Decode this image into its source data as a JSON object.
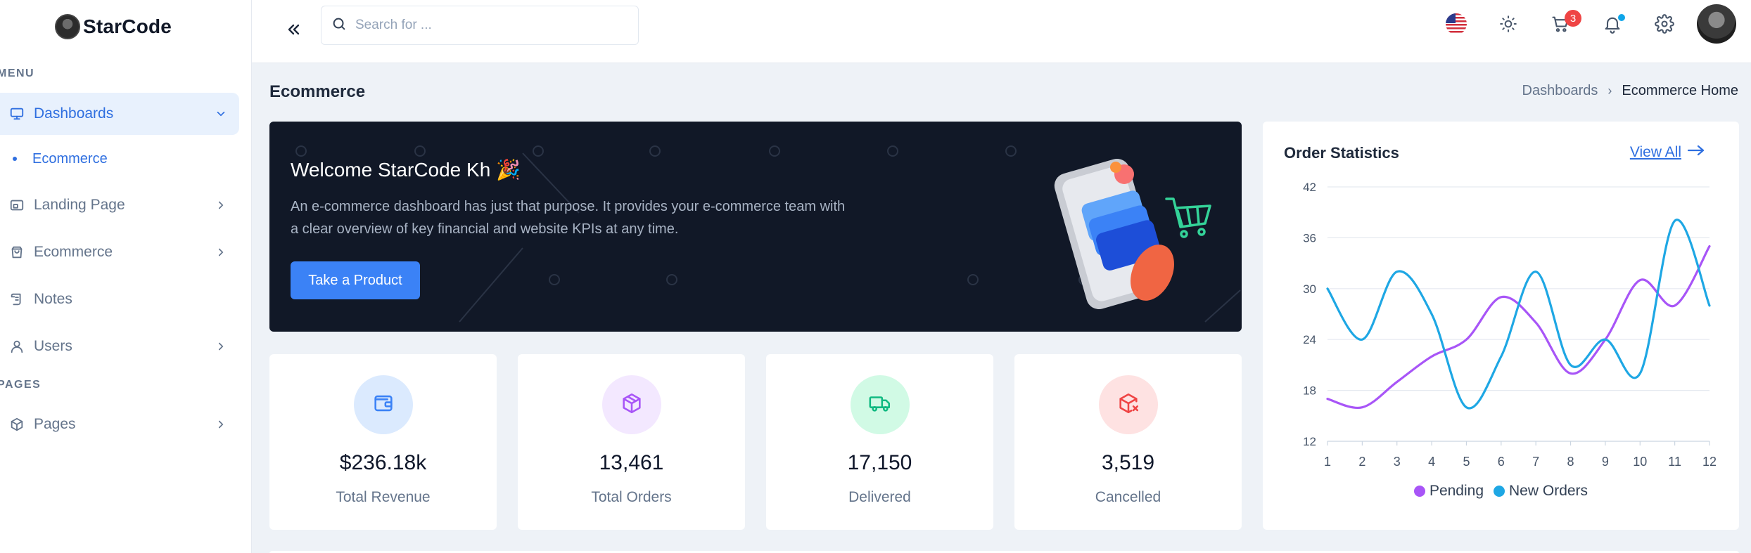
{
  "sidebar": {
    "logo_text": "StarCode",
    "menu_heading": "Menu",
    "pages_heading": "Pages",
    "items": [
      {
        "label": "Dashboards",
        "icon": "monitor-icon",
        "active": true,
        "has_children": true
      },
      {
        "label": "Ecommerce",
        "sub": true
      },
      {
        "label": "Landing Page",
        "icon": "layout-icon",
        "has_children": true
      },
      {
        "label": "Ecommerce",
        "icon": "shopping-bag-icon",
        "has_children": true
      },
      {
        "label": "Notes",
        "icon": "scroll-icon",
        "has_children": false
      },
      {
        "label": "Users",
        "icon": "user-icon",
        "has_children": true
      },
      {
        "label": "Pages",
        "icon": "cube-icon",
        "has_children": true
      }
    ]
  },
  "topbar": {
    "search_placeholder": "Search for ...",
    "cart_count": "3",
    "icons": [
      "us-flag-icon",
      "sun-icon",
      "cart-icon",
      "bell-icon",
      "gear-icon"
    ]
  },
  "page": {
    "title": "Ecommerce",
    "breadcrumb": {
      "parent": "Dashboards",
      "separator": "›",
      "current": "Ecommerce Home"
    }
  },
  "banner": {
    "title": "Welcome StarCode Kh 🎉",
    "description": "An e-commerce dashboard has just that purpose. It provides your e-commerce team with a clear overview of key financial and website KPIs at any time.",
    "button_label": "Take a Product"
  },
  "stats": [
    {
      "value": "$236.18k",
      "label": "Total Revenue",
      "icon": "wallet-icon",
      "color": "#3b82f6",
      "bg": "#dbeafe"
    },
    {
      "value": "13,461",
      "label": "Total Orders",
      "icon": "package-icon",
      "color": "#a855f7",
      "bg": "#f3e8ff"
    },
    {
      "value": "17,150",
      "label": "Delivered",
      "icon": "truck-icon",
      "color": "#10b981",
      "bg": "#d1fae5"
    },
    {
      "value": "3,519",
      "label": "Cancelled",
      "icon": "package-x-icon",
      "color": "#ef4444",
      "bg": "#fee2e2"
    }
  ],
  "order_stats": {
    "title": "Order Statistics",
    "view_all_label": "View All"
  },
  "chart_data": {
    "type": "line",
    "title": "Order Statistics",
    "x": [
      1,
      2,
      3,
      4,
      5,
      6,
      7,
      8,
      9,
      10,
      11,
      12
    ],
    "ylim": [
      12,
      42
    ],
    "yticks": [
      12,
      18,
      24,
      30,
      36,
      42
    ],
    "grid": true,
    "legend_position": "bottom",
    "series": [
      {
        "name": "Pending",
        "color": "#a855f7",
        "values": [
          17,
          16,
          19,
          22,
          24,
          29,
          26,
          20,
          24,
          31,
          28,
          35
        ]
      },
      {
        "name": "New Orders",
        "color": "#1ea7e4",
        "values": [
          30,
          24,
          32,
          27,
          16,
          22,
          32,
          21,
          24,
          20,
          38,
          28
        ]
      }
    ]
  },
  "colors": {
    "accent": "#2f6fe0",
    "banner_bg": "#111827",
    "button": "#3b82f6"
  }
}
